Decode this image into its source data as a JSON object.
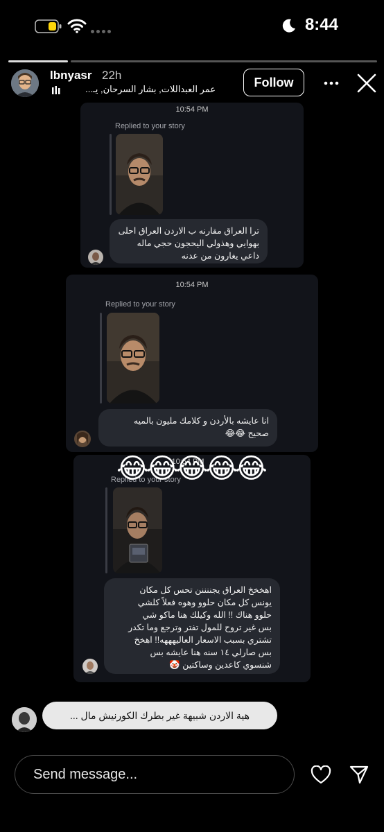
{
  "status_bar": {
    "time": "8:44"
  },
  "story": {
    "username": "lbnyasr",
    "time_ago": "22h",
    "music_text": "عمر العبداللات, بشار السرحان, يـ...",
    "follow_label": "Follow"
  },
  "chat": {
    "messages": [
      {
        "timestamp": "10:54 PM",
        "replied_label": "Replied to your story",
        "text": "ترا العراق مقارنه ب الاردن العراق احلى\nبهوايي وهذولي اليحجون حجي ماله\nداعي يغارون من عدنه"
      },
      {
        "timestamp": "10:54 PM",
        "replied_label": "Replied to your story",
        "text": "انا عايشه بالأردن و كلامك مليون بالميه\nصحيح 😂😂"
      },
      {
        "timestamp": "10:54 PM",
        "replied_label": "Replied to your story",
        "text": "اهخخخ العراق يجننننن تحس كل مكان\nيونس كل مكان حلوو وهوه فعلاً كلشي\nحلوو هناك !! الله وكيلك هنا ماكو شي\nبس غير تروح للمول تفتر وترجع وما تكدر\nتشتري بسبب الاسعار العاليهههه!! اهخخ\nبس صارلي ١٤ سنه هنا عايشه بس\nشنسوي كاعدين وساكتين 🤡"
      }
    ],
    "emoji_overlay": "😂😂😂😂😂"
  },
  "comment": {
    "text": "هية الاردن شبيهة غير بطرك الكورنيش مال ..."
  },
  "message_bar": {
    "placeholder": "Send message..."
  }
}
